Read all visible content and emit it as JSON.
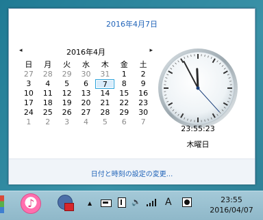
{
  "flyout": {
    "full_date": "2016年4月7日",
    "calendar": {
      "month_label": "2016年4月",
      "prev_arrow": "◂",
      "next_arrow": "▸",
      "weekdays": [
        "日",
        "月",
        "火",
        "水",
        "木",
        "金",
        "土"
      ],
      "weeks": [
        [
          {
            "d": "27",
            "dim": true
          },
          {
            "d": "28",
            "dim": true
          },
          {
            "d": "29",
            "dim": true
          },
          {
            "d": "30",
            "dim": true
          },
          {
            "d": "31",
            "dim": true
          },
          {
            "d": "1"
          },
          {
            "d": "2"
          }
        ],
        [
          {
            "d": "3"
          },
          {
            "d": "4"
          },
          {
            "d": "5"
          },
          {
            "d": "6"
          },
          {
            "d": "7",
            "selected": true
          },
          {
            "d": "8"
          },
          {
            "d": "9"
          }
        ],
        [
          {
            "d": "10"
          },
          {
            "d": "11"
          },
          {
            "d": "12"
          },
          {
            "d": "13"
          },
          {
            "d": "14"
          },
          {
            "d": "15"
          },
          {
            "d": "16"
          }
        ],
        [
          {
            "d": "17"
          },
          {
            "d": "18"
          },
          {
            "d": "19"
          },
          {
            "d": "20"
          },
          {
            "d": "21"
          },
          {
            "d": "22"
          },
          {
            "d": "23"
          }
        ],
        [
          {
            "d": "24"
          },
          {
            "d": "25"
          },
          {
            "d": "26"
          },
          {
            "d": "27"
          },
          {
            "d": "28"
          },
          {
            "d": "29"
          },
          {
            "d": "30"
          }
        ],
        [
          {
            "d": "1",
            "dim": true
          },
          {
            "d": "2",
            "dim": true
          },
          {
            "d": "3",
            "dim": true
          },
          {
            "d": "4",
            "dim": true
          },
          {
            "d": "5",
            "dim": true
          },
          {
            "d": "6",
            "dim": true
          },
          {
            "d": "7",
            "dim": true
          }
        ]
      ]
    },
    "clock": {
      "hour": 23,
      "minute": 55,
      "second": 23
    },
    "time_text": "23:55:23",
    "day_text": "木曜日",
    "settings_link": "日付と時刻の設定の変更..."
  },
  "taskbar": {
    "icons": [
      "itunes-icon",
      "security-app-icon",
      "show-hidden-icons",
      "battery-icon",
      "network-adapter-icon",
      "volume-icon",
      "signal-icon",
      "ime-mode-icon",
      "night-mode-icon"
    ],
    "ime_label": "A",
    "tray_arrow": "▲",
    "clock_time": "23:55",
    "clock_date": "2016/04/07"
  },
  "colors": {
    "accent": "#1e62b8",
    "selection": "#26a0da"
  }
}
